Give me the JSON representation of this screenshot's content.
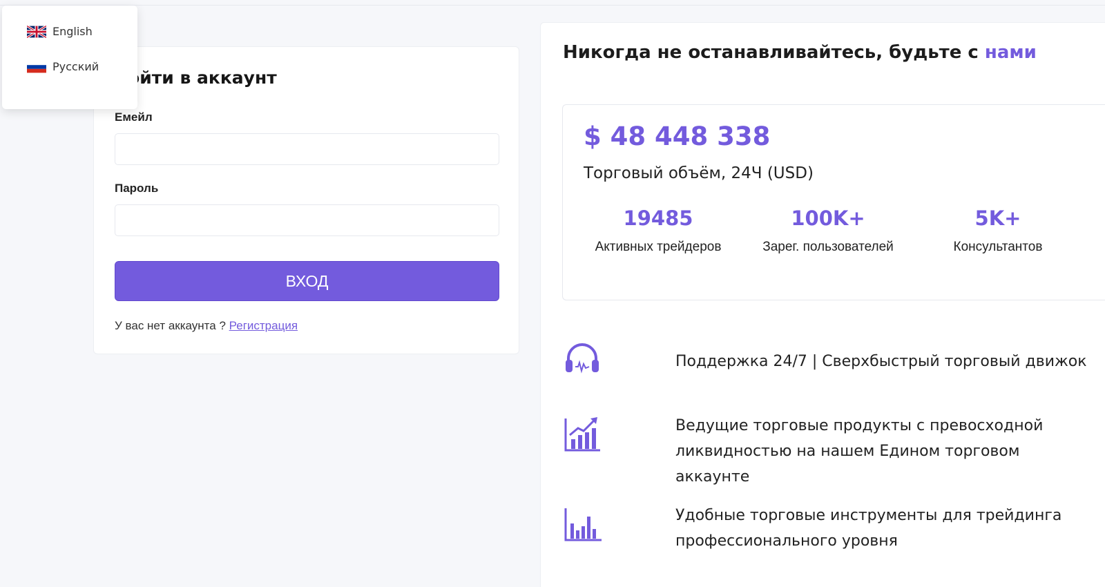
{
  "language_menu": {
    "items": [
      {
        "label": "English",
        "flag": "uk-flag"
      },
      {
        "label": "Русский",
        "flag": "russia-flag"
      }
    ]
  },
  "login": {
    "title": "Войти в аккаунт",
    "email_label": "Емейл",
    "email_value": "",
    "password_label": "Пароль",
    "password_value": "",
    "submit_label": "ВХОД",
    "no_account_text": "У вас нет аккаунта ?",
    "register_link": "Регистрация"
  },
  "promo": {
    "headline": "Никогда не останавливайтесь, будьте с",
    "headline_accent": "нами",
    "volume": "$ 48 448 338",
    "volume_label": "Торговый объём, 24Ч (USD)",
    "stats": [
      {
        "value": "19485",
        "label": "Активных трейдеров"
      },
      {
        "value": "100K+",
        "label": "Зарег. пользователей"
      },
      {
        "value": "5K+",
        "label": "Консультантов"
      }
    ],
    "features": [
      {
        "icon": "headset-icon",
        "text": "Поддержка 24/7 | Сверхбыстрый торговый движок"
      },
      {
        "icon": "growth-chart-icon",
        "text": "Ведущие торговые продукты с превосходной ликвидностью на нашем Едином торговом аккаунте"
      },
      {
        "icon": "bar-chart-icon",
        "text": "Удобные торговые инструменты для трейдинга профессионального уровня"
      }
    ]
  },
  "colors": {
    "accent": "#735bdd",
    "background": "#f6f7fa"
  }
}
